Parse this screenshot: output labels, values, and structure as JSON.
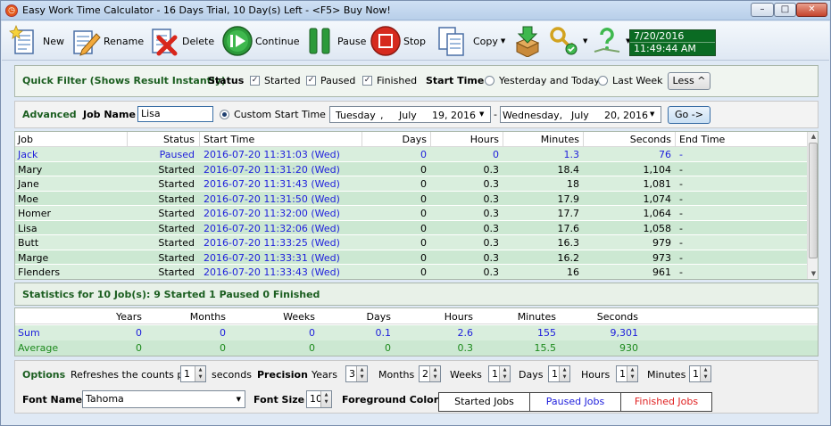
{
  "window": {
    "title": "Easy Work Time Calculator - 16 Days Trial, 10 Day(s) Left - <F5> Buy Now!",
    "min_symbol": "–",
    "max_symbol": "□",
    "close_symbol": "✕"
  },
  "toolbar": {
    "new": "New",
    "rename": "Rename",
    "delete": "Delete",
    "continue": "Continue",
    "pause": "Pause",
    "stop": "Stop",
    "copy": "Copy",
    "date": "7/20/2016",
    "time": "11:49:44 AM"
  },
  "quick_filter": {
    "title": "Quick Filter (Shows Result Instantly)",
    "status_label": "Status",
    "started": "Started",
    "paused": "Paused",
    "finished": "Finished",
    "start_time_label": "Start Time",
    "yesterday_today": "Yesterday and Today",
    "last_week": "Last Week",
    "less_button": "Less ^"
  },
  "advanced": {
    "title": "Advanced",
    "job_name_label": "Job Name",
    "job_name_value": "Lisa",
    "custom_start_time": "Custom Start Time",
    "from_day": "Tuesday",
    "from_month": "July",
    "from_date": "19, 2016",
    "dash": "-",
    "to_day": "Wednesday,",
    "to_month": "July",
    "to_date": "20, 2016",
    "go_button": "Go ->"
  },
  "jobs_table": {
    "headers": [
      "Job",
      "Status",
      "Start Time",
      "Days",
      "Hours",
      "Minutes",
      "Seconds",
      "End Time"
    ],
    "rows": [
      [
        "Jack",
        "Paused",
        "2016-07-20 11:31:03 (Wed)",
        "0",
        "0",
        "1.3",
        "76",
        "-"
      ],
      [
        "Mary",
        "Started",
        "2016-07-20 11:31:20 (Wed)",
        "0",
        "0.3",
        "18.4",
        "1,104",
        "-"
      ],
      [
        "Jane",
        "Started",
        "2016-07-20 11:31:43 (Wed)",
        "0",
        "0.3",
        "18",
        "1,081",
        "-"
      ],
      [
        "Moe",
        "Started",
        "2016-07-20 11:31:50 (Wed)",
        "0",
        "0.3",
        "17.9",
        "1,074",
        "-"
      ],
      [
        "Homer",
        "Started",
        "2016-07-20 11:32:00 (Wed)",
        "0",
        "0.3",
        "17.7",
        "1,064",
        "-"
      ],
      [
        "Lisa",
        "Started",
        "2016-07-20 11:32:06 (Wed)",
        "0",
        "0.3",
        "17.6",
        "1,058",
        "-"
      ],
      [
        "Butt",
        "Started",
        "2016-07-20 11:33:25 (Wed)",
        "0",
        "0.3",
        "16.3",
        "979",
        "-"
      ],
      [
        "Marge",
        "Started",
        "2016-07-20 11:33:31 (Wed)",
        "0",
        "0.3",
        "16.2",
        "973",
        "-"
      ],
      [
        "Flenders",
        "Started",
        "2016-07-20 11:33:43 (Wed)",
        "0",
        "0.3",
        "16",
        "961",
        "-"
      ]
    ]
  },
  "statistics": {
    "title": "Statistics for 10 Job(s): 9 Started 1 Paused 0 Finished",
    "headers": [
      "Years",
      "Months",
      "Weeks",
      "Days",
      "Hours",
      "Minutes",
      "Seconds"
    ],
    "sum_label": "Sum",
    "sum": [
      "0",
      "0",
      "0",
      "0.1",
      "2.6",
      "155",
      "9,301"
    ],
    "avg_label": "Average",
    "avg": [
      "0",
      "0",
      "0",
      "0",
      "0.3",
      "15.5",
      "930"
    ]
  },
  "options": {
    "title": "Options",
    "refresh_label": "Refreshes the counts per",
    "refresh_value": "1",
    "seconds_label": "seconds",
    "precision_label": "Precision",
    "years_label": "Years",
    "years_value": "3",
    "months_label": "Months",
    "months_value": "2",
    "weeks_label": "Weeks",
    "weeks_value": "1",
    "days_label": "Days",
    "days_value": "1",
    "hours_label": "Hours",
    "hours_value": "1",
    "minutes_label": "Minutes",
    "minutes_value": "1",
    "font_name_label": "Font Name",
    "font_name_value": "Tahoma",
    "font_size_label": "Font Size",
    "font_size_value": "10",
    "fg_colors_label": "Foreground Colors",
    "started_jobs": "Started Jobs",
    "paused_jobs": "Paused Jobs",
    "finished_jobs": "Finished Jobs"
  },
  "colors": {
    "paused": "#1e1edc",
    "finished": "#e02020",
    "sum": "#1e1edc",
    "average": "#1d8a1d",
    "clock_bg": "#0b6b23"
  }
}
